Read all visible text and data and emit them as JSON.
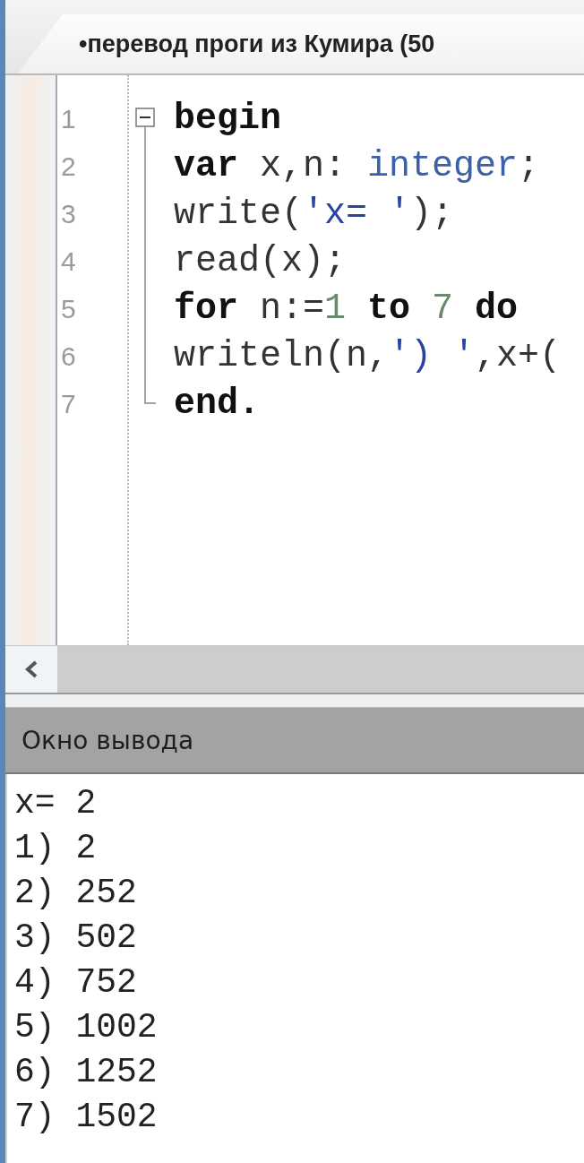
{
  "tab": {
    "title": "•перевод проги из Кумира (50",
    "selected": true
  },
  "editor": {
    "lines": [
      {
        "number": "1",
        "kind": "fold-start",
        "tokens": [
          {
            "kind": "keyword",
            "text": "begin"
          }
        ]
      },
      {
        "number": "2",
        "kind": "fold-body",
        "tokens": [
          {
            "kind": "keyword",
            "text": "var"
          },
          {
            "kind": "plain",
            "text": " x,n: "
          },
          {
            "kind": "type",
            "text": "integer"
          },
          {
            "kind": "plain",
            "text": ";"
          }
        ]
      },
      {
        "number": "3",
        "kind": "fold-body",
        "tokens": [
          {
            "kind": "plain",
            "text": "write("
          },
          {
            "kind": "string",
            "text": "'x= '"
          },
          {
            "kind": "plain",
            "text": ");"
          }
        ]
      },
      {
        "number": "4",
        "kind": "fold-body",
        "tokens": [
          {
            "kind": "plain",
            "text": "read(x);"
          }
        ]
      },
      {
        "number": "5",
        "kind": "fold-body",
        "tokens": [
          {
            "kind": "keyword",
            "text": "for"
          },
          {
            "kind": "plain",
            "text": " n:="
          },
          {
            "kind": "number",
            "text": "1"
          },
          {
            "kind": "keyword",
            "text": " to"
          },
          {
            "kind": "number",
            "text": " 7"
          },
          {
            "kind": "keyword",
            "text": " do"
          }
        ]
      },
      {
        "number": "6",
        "kind": "fold-body",
        "tokens": [
          {
            "kind": "plain",
            "text": "writeln(n,"
          },
          {
            "kind": "string",
            "text": "') '"
          },
          {
            "kind": "plain",
            "text": ",x+("
          }
        ]
      },
      {
        "number": "7",
        "kind": "fold-end",
        "tokens": [
          {
            "kind": "keyword",
            "text": "end."
          }
        ]
      }
    ]
  },
  "output": {
    "title": "Окно вывода",
    "lines": [
      "x= 2",
      "1) 2",
      "2) 252",
      "3) 502",
      "4) 752",
      "5) 1002",
      "6) 1252",
      "7) 1502"
    ]
  }
}
